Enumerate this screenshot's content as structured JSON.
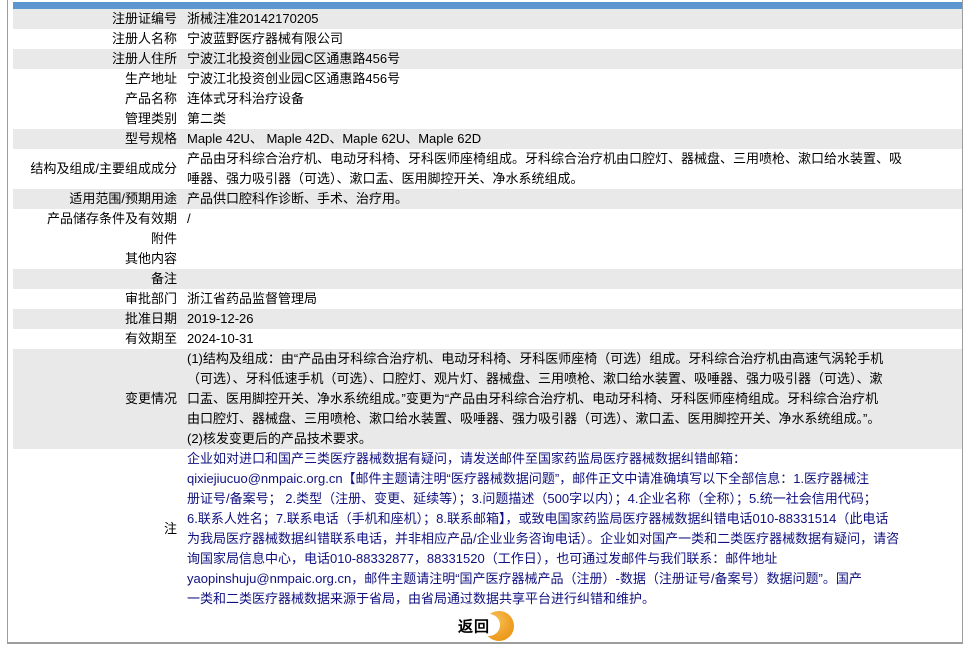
{
  "colors": {
    "header_bar_blue": "#5e97cf",
    "row_shade_gray": "#e9e9e9",
    "note_text_navy": "#101080",
    "button_orange": "#efa127",
    "frame_border_gray": "#9d9d9d"
  },
  "table": {
    "rows": [
      {
        "label": "注册证编号",
        "value": "浙械注准20142170205",
        "shaded": true
      },
      {
        "label": "注册人名称",
        "value": "宁波蓝野医疗器械有限公司",
        "shaded": false
      },
      {
        "label": "注册人住所",
        "value": "宁波江北投资创业园C区通惠路456号",
        "shaded": true
      },
      {
        "label": "生产地址",
        "value": "宁波江北投资创业园C区通惠路456号",
        "shaded": false
      },
      {
        "label": "产品名称",
        "value": "连体式牙科治疗设备",
        "shaded": false
      },
      {
        "label": "管理类别",
        "value": "第二类",
        "shaded": false
      },
      {
        "label": "型号规格",
        "value": "Maple 42U、 Maple 42D、Maple 62U、Maple 62D",
        "shaded": true
      },
      {
        "label": "结构及组成/主要组成成分",
        "value": "产品由牙科综合治疗机、电动牙科椅、牙科医师座椅组成。牙科综合治疗机由口腔灯、器械盘、三用喷枪、漱口给水装置、吸\n唾器、强力吸引器（可选）、漱口盂、医用脚控开关、净水系统组成。",
        "shaded": false
      },
      {
        "label": "适用范围/预期用途",
        "value": "产品供口腔科作诊断、手术、治疗用。",
        "shaded": true
      },
      {
        "label": "产品储存条件及有效期",
        "value": "/",
        "shaded": false
      },
      {
        "label": "附件",
        "value": "",
        "shaded": false
      },
      {
        "label": "其他内容",
        "value": "",
        "shaded": false
      },
      {
        "label": "备注",
        "value": "",
        "shaded": true
      },
      {
        "label": "审批部门",
        "value": "浙江省药品监督管理局",
        "shaded": false
      },
      {
        "label": "批准日期",
        "value": "2019-12-26",
        "shaded": true
      },
      {
        "label": "有效期至",
        "value": "2024-10-31",
        "shaded": false
      },
      {
        "label": "变更情况",
        "value": "(1)结构及组成：由“产品由牙科综合治疗机、电动牙科椅、牙科医师座椅（可选）组成。牙科综合治疗机由高速气涡轮手机\n（可选）、牙科低速手机（可选）、口腔灯、观片灯、器械盘、三用喷枪、漱口给水装置、吸唾器、强力吸引器（可选）、漱\n口盂、医用脚控开关、净水系统组成。”变更为“产品由牙科综合治疗机、电动牙科椅、牙科医师座椅组成。牙科综合治疗机\n由口腔灯、器械盘、三用喷枪、漱口给水装置、吸唾器、强力吸引器（可选）、漱口盂、医用脚控开关、净水系统组成。”。\n(2)核发变更后的产品技术要求。",
        "shaded": true
      },
      {
        "label": "注",
        "value": "企业如对进口和国产三类医疗器械数据有疑问，请发送邮件至国家药监局医疗器械数据纠错邮箱：\nqixiejiucuo@nmpaic.org.cn【邮件主题请注明“医疗器械数据问题”，邮件正文中请准确填写以下全部信息：1.医疗器械注\n册证号/备案号； 2.类型（注册、变更、延续等）；3.问题描述（500字以内）；4.企业名称（全称）；5.统一社会信用代码；\n6.联系人姓名；7.联系电话（手机和座机）；8.联系邮箱】，或致电国家药监局医疗器械数据纠错电话010-88331514（此电话\n为我局医疗器械数据纠错联系电话，并非相应产品/企业业务咨询电话）。企业如对国产一类和二类医疗器械数据有疑问，请咨\n询国家局信息中心，电话010-88332877，88331520（工作日），也可通过发邮件与我们联系：邮件地址\nyaopinshuju@nmpaic.org.cn，邮件主题请注明“国产医疗器械产品（注册）-数据（注册证号/备案号）数据问题”。国产\n一类和二类医疗器械数据来源于省局，由省局通过数据共享平台进行纠错和维护。",
        "shaded": false
      }
    ]
  },
  "footer": {
    "return_label": "返回"
  }
}
